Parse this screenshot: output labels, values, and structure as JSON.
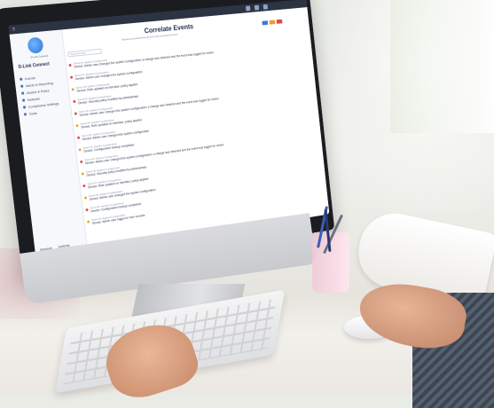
{
  "app": {
    "brand_name": "D-Link Connect",
    "user_name": "D-Link Connect",
    "page_title": "Correlate Events",
    "page_subtitle": "Showing correlated events from all connected sources",
    "search_placeholder": "Search Events"
  },
  "sidebar": {
    "items": [
      {
        "label": "Events"
      },
      {
        "label": "Alerts & Reporting"
      },
      {
        "label": "Assets & Rules"
      },
      {
        "label": "Network"
      },
      {
        "label": "Compliance Settings"
      },
      {
        "label": "Tools"
      }
    ],
    "footer": [
      "Manage",
      "Settings"
    ]
  },
  "events": [
    {
      "status": "error",
      "source": "Event ID: Applied Configuration",
      "message": "Device: Admin user changed the system configuration; a change was detected and the event was logged for review"
    },
    {
      "status": "error",
      "source": "Event ID: Applied Configuration",
      "message": "Device: Admin user changed the system configuration"
    },
    {
      "status": "warning",
      "source": "Event ID: Applied Configuration",
      "message": "Device: Rule updated on interface; policy applied"
    },
    {
      "status": "error",
      "source": "Event ID: Applied Configuration",
      "message": "Device: Security policy modified by administrator"
    },
    {
      "status": "error",
      "source": "Event ID: Applied Configuration",
      "message": "Device: Admin user changed the system configuration; a change was detected and the event was logged for review"
    },
    {
      "status": "warning",
      "source": "Event ID: Applied Configuration",
      "message": "Device: Rule updated on interface; policy applied"
    },
    {
      "status": "error",
      "source": "Event ID: Applied Configuration",
      "message": "Device: Admin user changed the system configuration"
    },
    {
      "status": "warning",
      "source": "Event ID: Applied Configuration",
      "message": "Device: Configuration backup completed"
    },
    {
      "status": "error",
      "source": "Event ID: Applied Configuration",
      "message": "Device: Admin user changed the system configuration; a change was detected and the event was logged for review"
    },
    {
      "status": "warning",
      "source": "Event ID: Applied Configuration",
      "message": "Device: Security policy modified by administrator"
    },
    {
      "status": "error",
      "source": "Event ID: Applied Configuration",
      "message": "Device: Rule updated on interface; policy applied"
    },
    {
      "status": "warning",
      "source": "Event ID: Applied Configuration",
      "message": "Device: Admin user changed the system configuration"
    },
    {
      "status": "error",
      "source": "Event ID: Applied Configuration",
      "message": "Device: Configuration backup completed"
    },
    {
      "status": "warning",
      "source": "Event ID: Applied Configuration",
      "message": "Device: Admin user logged in from console"
    }
  ],
  "colors": {
    "error": "#e0433b",
    "warning": "#f0a126",
    "brand": "#2e6fd6",
    "btn_blue": "#3b7be0",
    "btn_orange": "#f29a2e",
    "btn_red": "#e24a45"
  },
  "icons": [
    "menu-icon",
    "notification-icon",
    "settings-icon",
    "user-icon",
    "search-icon"
  ]
}
